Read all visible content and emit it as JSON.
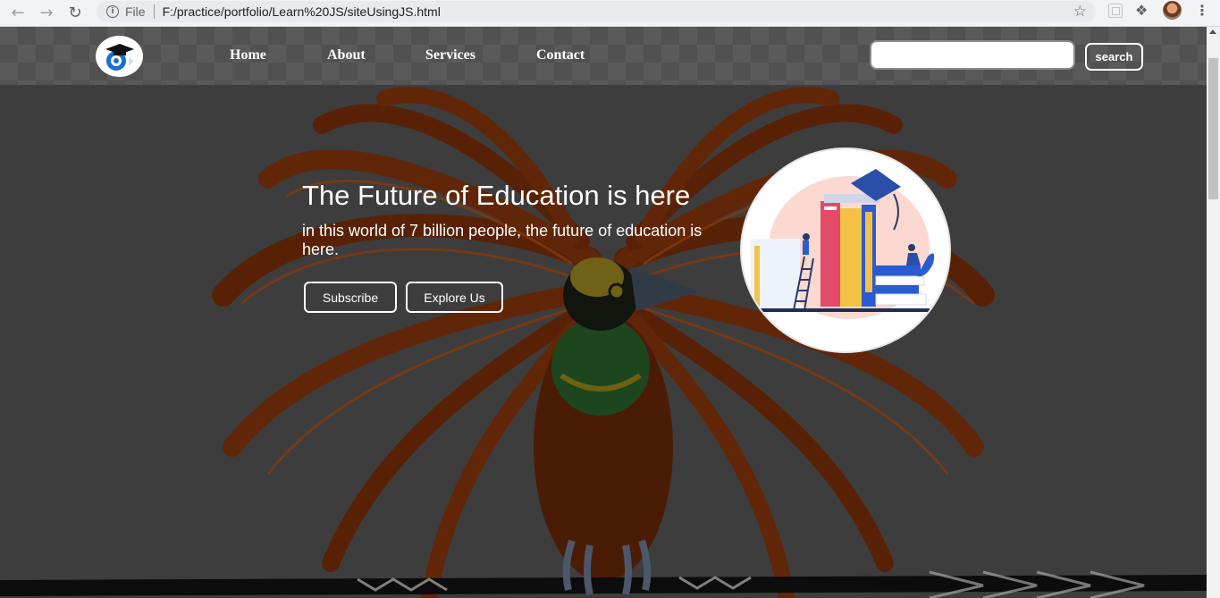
{
  "browser": {
    "file_label": "File",
    "url": "F:/practice/portfolio/Learn%20JS/siteUsingJS.html"
  },
  "nav": {
    "links": [
      "Home",
      "About",
      "Services",
      "Contact"
    ],
    "search_placeholder": "",
    "search_value": "",
    "search_button": "search"
  },
  "hero": {
    "title": "The Future of Education is here",
    "subtitle": "in this world of 7 billion people, the future of education is here.",
    "buttons": [
      "Subscribe",
      "Explore Us"
    ]
  },
  "icons": {
    "back": "arrow-left-icon",
    "forward": "arrow-right-icon",
    "reload": "reload-icon",
    "info": "info-icon",
    "bookmark": "star-icon",
    "extensions": "puzzle-icon",
    "menu": "kebab-menu-icon",
    "logo": "graduation-cap-logo",
    "hero": "education-books-illustration"
  },
  "colors": {
    "page_overlay": "#4d4d4d",
    "text": "#ffffff",
    "bird_brown": "#7a2e08",
    "bird_orange": "#b5520f",
    "bird_green": "#1f6b2c",
    "bird_yellow": "#b9a024"
  }
}
